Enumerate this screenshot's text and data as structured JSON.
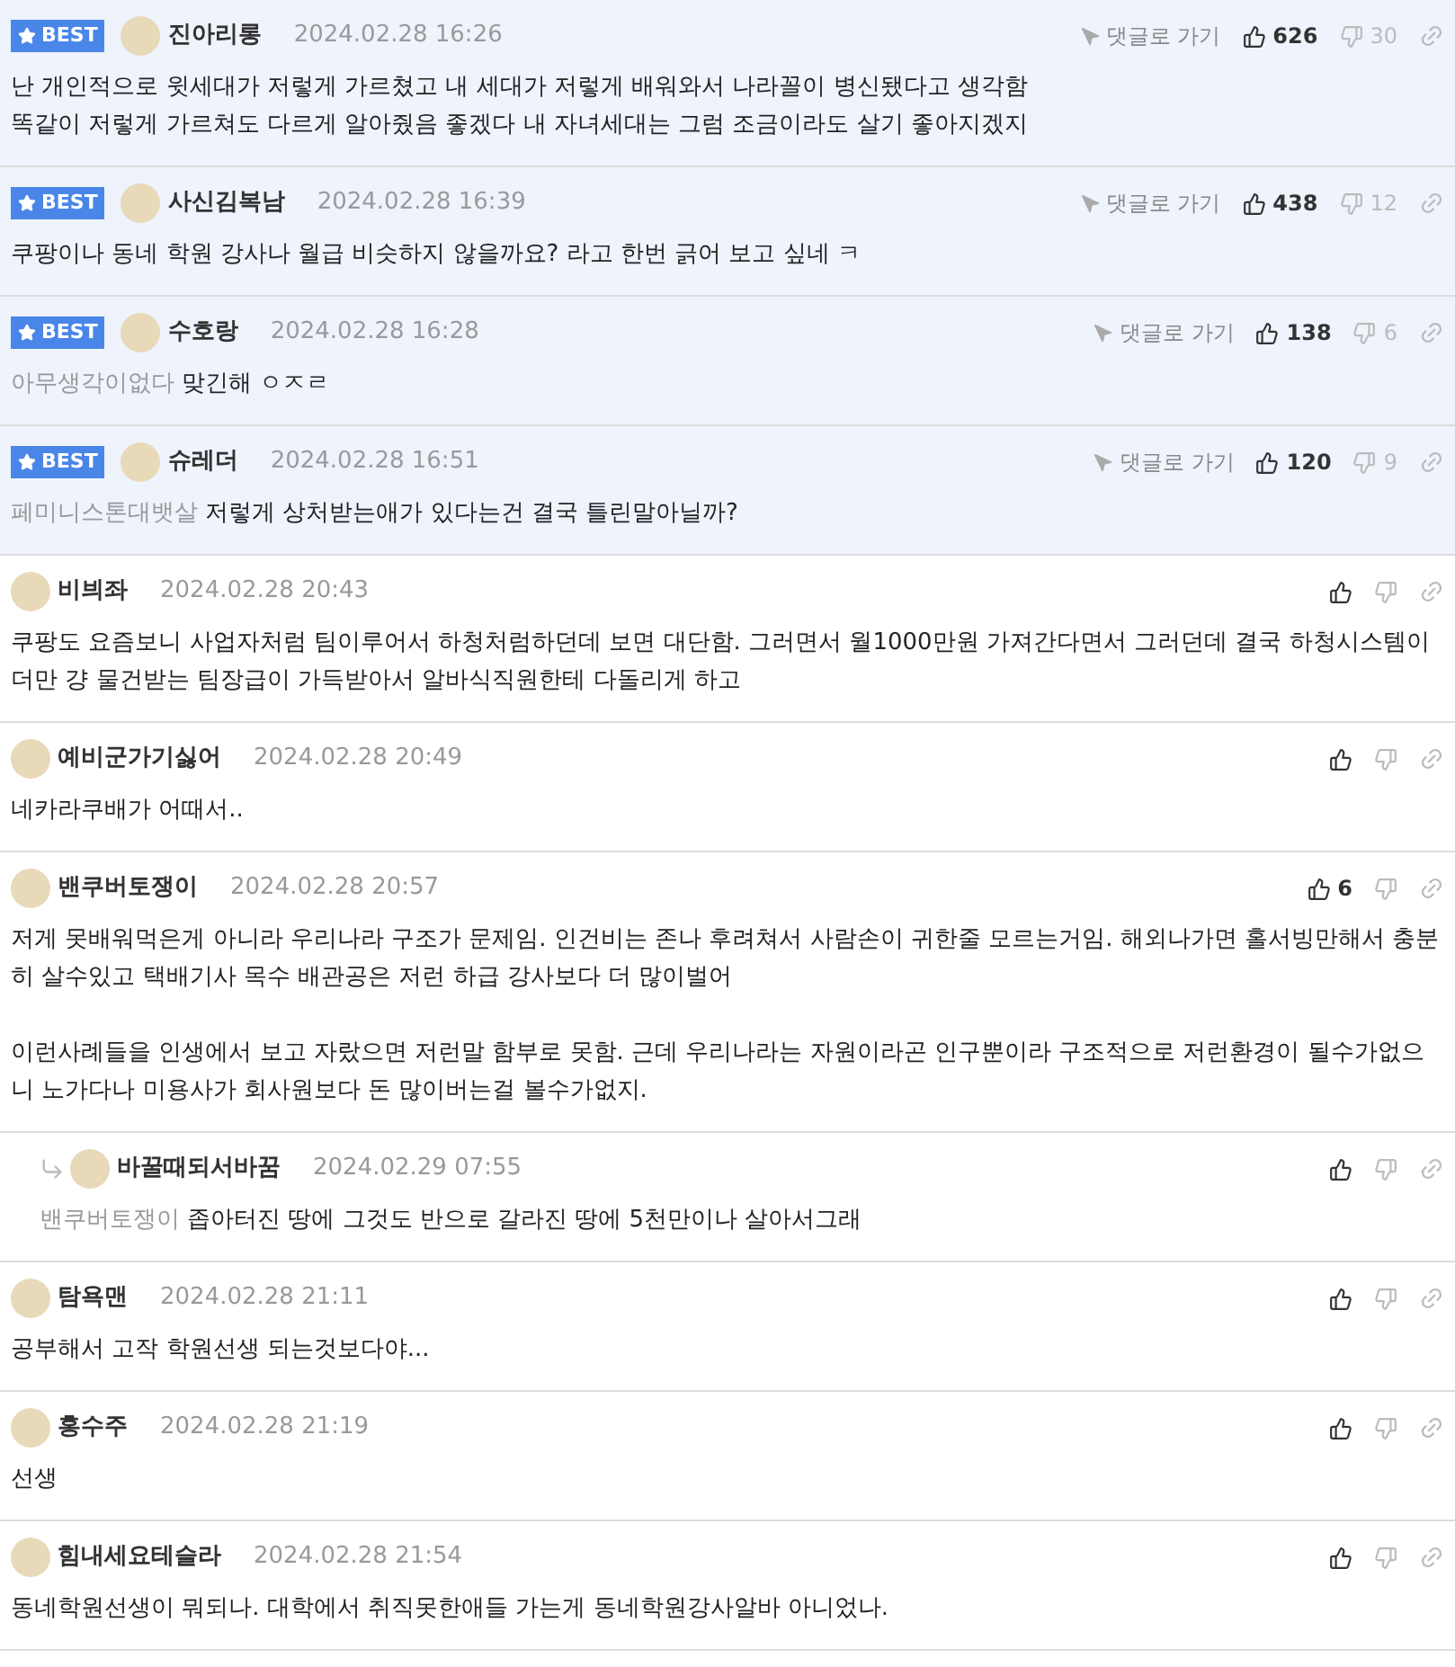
{
  "comments": [
    {
      "best": true,
      "best_label": "BEST",
      "author": "진아리롱",
      "date": "2024.02.28 16:26",
      "goto": "댓글로 가기",
      "likes": "626",
      "dislikes": "30",
      "reply": false,
      "paragraphs": [
        "난 개인적으로 윗세대가 저렇게 가르쳤고 내 세대가 저렇게 배워와서 나라꼴이 병신됐다고 생각함\n똑같이 저렇게 가르쳐도 다르게 알아줬음 좋겠다 내 자녀세대는 그럼 조금이라도 살기 좋아지겠지"
      ]
    },
    {
      "best": true,
      "best_label": "BEST",
      "author": "사신김복남",
      "date": "2024.02.28 16:39",
      "goto": "댓글로 가기",
      "likes": "438",
      "dislikes": "12",
      "reply": false,
      "paragraphs": [
        "쿠팡이나 동네 학원 강사나 월급 비슷하지 않을까요? 라고 한번 긁어 보고 싶네 ㅋ"
      ]
    },
    {
      "best": true,
      "best_label": "BEST",
      "author": "수호랑",
      "date": "2024.02.28 16:28",
      "goto": "댓글로 가기",
      "likes": "138",
      "dislikes": "6",
      "reply": false,
      "mention": "아무생각이없다",
      "paragraphs": [
        "맞긴해 ㅇㅈㄹ"
      ]
    },
    {
      "best": true,
      "best_label": "BEST",
      "author": "슈레더",
      "date": "2024.02.28 16:51",
      "goto": "댓글로 가기",
      "likes": "120",
      "dislikes": "9",
      "reply": false,
      "mention": "페미니스톤대뱃살",
      "paragraphs": [
        "저렇게 상처받는애가 있다는건 결국 틀린말아닐까?"
      ]
    },
    {
      "best": false,
      "author": "비븨좌",
      "date": "2024.02.28 20:43",
      "reply": false,
      "paragraphs": [
        "쿠팡도 요즘보니 사업자처럼 팀이루어서 하청처럼하던데 보면 대단함. 그러면서 월1000만원 가져간다면서 그러던데 결국 하청시스템이 더만 걍 물건받는 팀장급이 가득받아서 알바식직원한테 다돌리게 하고"
      ]
    },
    {
      "best": false,
      "author": "예비군가기싫어",
      "date": "2024.02.28 20:49",
      "reply": false,
      "paragraphs": [
        "네카라쿠배가 어때서.."
      ]
    },
    {
      "best": false,
      "author": "밴쿠버토쟁이",
      "date": "2024.02.28 20:57",
      "likes": "6",
      "reply": false,
      "paragraphs": [
        "저게 못배워먹은게 아니라 우리나라 구조가 문제임. 인건비는 존나 후려쳐서 사람손이 귀한줄 모르는거임. 해외나가면 홀서빙만해서 충분히 살수있고 택배기사 목수 배관공은 저런 하급 강사보다 더 많이벌어",
        "이런사례들을 인생에서 보고 자랐으면 저런말 함부로 못함. 근데 우리나라는 자원이라곤 인구뿐이라 구조적으로 저런환경이 될수가없으니 노가다나 미용사가 회사원보다 돈 많이버는걸 볼수가없지."
      ]
    },
    {
      "best": false,
      "author": "바꿀때되서바꿈",
      "date": "2024.02.29 07:55",
      "reply": true,
      "mention": "밴쿠버토쟁이",
      "paragraphs": [
        "좁아터진 땅에 그것도 반으로 갈라진 땅에 5천만이나 살아서그래"
      ]
    },
    {
      "best": false,
      "author": "탐욕맨",
      "date": "2024.02.28 21:11",
      "reply": false,
      "paragraphs": [
        "공부해서 고작 학원선생 되는것보다야..."
      ]
    },
    {
      "best": false,
      "author": "홍수주",
      "date": "2024.02.28 21:19",
      "reply": false,
      "paragraphs": [
        "선생"
      ]
    },
    {
      "best": false,
      "author": "힘내세요테슬라",
      "date": "2024.02.28 21:54",
      "reply": false,
      "paragraphs": [
        "동네학원선생이 뭐되나. 대학에서 취직못한애들 가는게 동네학원강사알바 아니었나."
      ]
    }
  ]
}
